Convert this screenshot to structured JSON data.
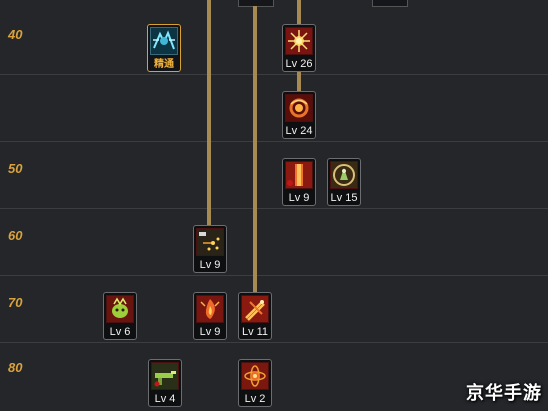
{
  "rows": [
    {
      "label": "40"
    },
    {
      "label": ""
    },
    {
      "label": "50"
    },
    {
      "label": "60"
    },
    {
      "label": "70"
    },
    {
      "label": "80"
    }
  ],
  "skills": [
    {
      "name": "awakening-mastery",
      "icon": "lightning-spider-icon",
      "label": "精通"
    },
    {
      "name": "skill-a",
      "icon": "sunburst-icon",
      "label": "Lv 26"
    },
    {
      "name": "skill-b",
      "icon": "swirl-orb-icon",
      "label": "Lv 24"
    },
    {
      "name": "skill-c",
      "icon": "flame-pillar-icon",
      "label": "Lv 9"
    },
    {
      "name": "skill-d",
      "icon": "shield-figure-icon",
      "label": "Lv 15"
    },
    {
      "name": "skill-e",
      "icon": "scatter-shot-icon",
      "label": "Lv 9"
    },
    {
      "name": "skill-f",
      "icon": "beast-icon",
      "label": "Lv 6"
    },
    {
      "name": "skill-g",
      "icon": "flame-burst-icon",
      "label": "Lv 9"
    },
    {
      "name": "skill-h",
      "icon": "dual-blade-icon",
      "label": "Lv 11"
    },
    {
      "name": "skill-i",
      "icon": "gun-icon",
      "label": "Lv 4"
    },
    {
      "name": "skill-j",
      "icon": "atom-icon",
      "label": "Lv 2"
    }
  ],
  "watermark": "京华手游",
  "colors": {
    "line": "#a78a52",
    "level_label": "#d8a23c",
    "mastery_border": "#d7a233"
  }
}
